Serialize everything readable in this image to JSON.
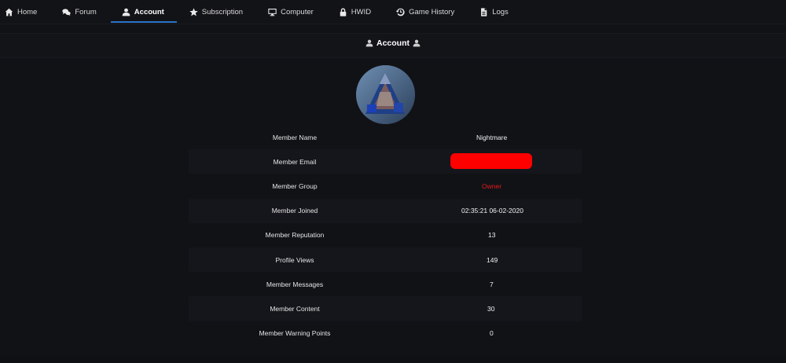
{
  "nav": {
    "items": [
      {
        "label": "Home",
        "icon": "home-icon"
      },
      {
        "label": "Forum",
        "icon": "comments-icon"
      },
      {
        "label": "Account",
        "icon": "user-icon",
        "active": true
      },
      {
        "label": "Subscription",
        "icon": "star-icon"
      },
      {
        "label": "Computer",
        "icon": "monitor-icon"
      },
      {
        "label": "HWID",
        "icon": "lock-icon"
      },
      {
        "label": "Game History",
        "icon": "history-icon"
      },
      {
        "label": "Logs",
        "icon": "file-icon"
      }
    ],
    "accent": "#2a73c8"
  },
  "panel": {
    "title": "Account"
  },
  "account": {
    "rows": [
      {
        "label": "Member Name",
        "value": "Nightmare"
      },
      {
        "label": "Member Email",
        "value": ""
      },
      {
        "label": "Member Group",
        "value": "Owner"
      },
      {
        "label": "Member Joined",
        "value": "02:35:21 06-02-2020"
      },
      {
        "label": "Member Reputation",
        "value": "13"
      },
      {
        "label": "Profile Views",
        "value": "149"
      },
      {
        "label": "Member Messages",
        "value": "7"
      },
      {
        "label": "Member Content",
        "value": "30"
      },
      {
        "label": "Member Warning Points",
        "value": "0"
      }
    ],
    "redaction_color": "#ff0000",
    "owner_color": "#e01c1c"
  }
}
